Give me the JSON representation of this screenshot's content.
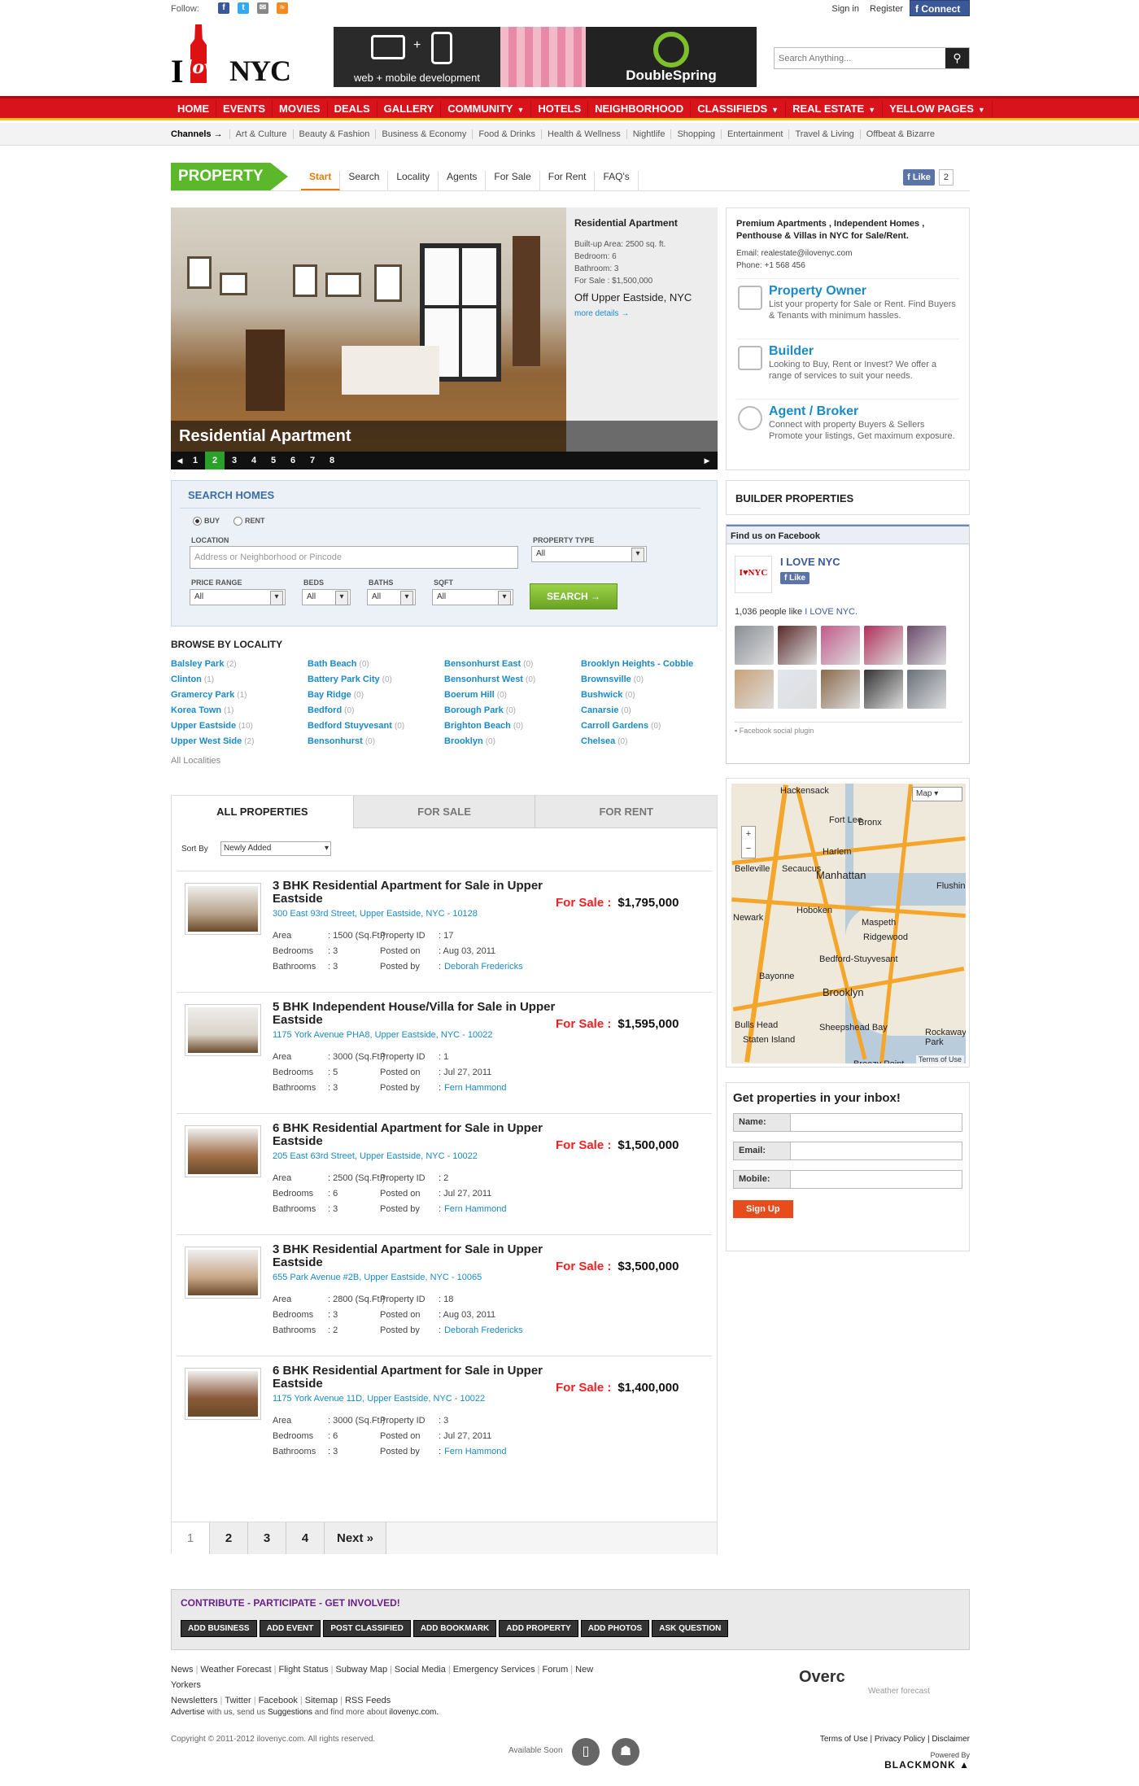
{
  "topbar": {
    "follow_label": "Follow:",
    "signin": "Sign in",
    "register": "Register",
    "connect": "Connect"
  },
  "header": {
    "logo_text_i": "I",
    "logo_text_love": "love",
    "logo_text_nyc": "NYC",
    "banner_left": "web + mobile development",
    "banner_right": "DoubleSpring",
    "search_placeholder": "Search Anything...",
    "search_icon": "magnifier-icon"
  },
  "nav": {
    "items": [
      "HOME",
      "EVENTS",
      "MOVIES",
      "DEALS",
      "GALLERY",
      "COMMUNITY",
      "HOTELS",
      "NEIGHBORHOOD",
      "CLASSIFIEDS",
      "REAL ESTATE",
      "YELLOW PAGES"
    ],
    "dropdown_items": [
      "COMMUNITY",
      "CLASSIFIEDS",
      "REAL ESTATE",
      "YELLOW PAGES"
    ]
  },
  "channels": {
    "label": "Channels →",
    "items": [
      "Art & Culture",
      "Beauty & Fashion",
      "Business & Economy",
      "Food & Drinks",
      "Health & Wellness",
      "Nightlife",
      "Shopping",
      "Entertainment",
      "Travel & Living",
      "Offbeat & Bizarre"
    ]
  },
  "property": {
    "badge": "PROPERTY",
    "tabs": [
      "Start",
      "Search",
      "Locality",
      "Agents",
      "For Sale",
      "For Rent",
      "FAQ's"
    ],
    "active_tab": "Start",
    "fb_like": "Like",
    "fb_like_count": "2"
  },
  "slider": {
    "side_title": "Residential Apartment",
    "area": "Built-up Area: 2500 sq. ft.",
    "bedroom": "Bedroom: 6",
    "bathroom": "Bathroom: 3",
    "for_sale": "For Sale : $1,500,000",
    "location": "Off Upper Eastside, NYC",
    "more": "more details →",
    "caption": "Residential Apartment",
    "pages": [
      "1",
      "2",
      "3",
      "4",
      "5",
      "6",
      "7",
      "8"
    ],
    "active_page": "2"
  },
  "owner": {
    "intro": "Premium Apartments , Independent Homes , Penthouse & Villas in NYC for Sale/Rent.",
    "email": "Email: realestate@ilovenyc.com",
    "phone": "Phone: +1 568 456",
    "items": [
      {
        "title": "Property Owner",
        "desc": "List your property for Sale or Rent. Find Buyers & Tenants with minimum hassles."
      },
      {
        "title": "Builder",
        "desc": "Looking to Buy, Rent or Invest? We offer a range of services to suit your needs."
      },
      {
        "title": "Agent / Broker",
        "desc": "Connect with property Buyers & Sellers Promote your listings, Get maximum exposure."
      }
    ]
  },
  "builder_properties": "BUILDER PROPERTIES",
  "facebook": {
    "header": "Find us on Facebook",
    "page_name": "I LOVE NYC",
    "like": "Like",
    "people_prefix": "1,036 people like",
    "people_page": "I LOVE NYC.",
    "plugin": "Facebook social plugin",
    "face_colors": [
      "#8a8f94",
      "#5a2a2a",
      "#c25a8a",
      "#b0305a",
      "#6a4a6a",
      "#caa27a",
      "#e2e6ec",
      "#8a6a4a",
      "#333333",
      "#6a7078"
    ]
  },
  "map": {
    "type_label": "Map",
    "terms": "Terms of Use",
    "labels": [
      "Hackensack",
      "Fort Lee",
      "Bronx",
      "Harlem",
      "Manhattan",
      "Secaucus",
      "Belleville",
      "Hoboken",
      "Newark",
      "Maspeth",
      "Ridgewood",
      "Bedford-Stuyvesant",
      "Bayonne",
      "Brooklyn",
      "Bulls Head",
      "Staten Island",
      "Sheepshead Bay",
      "Breezy Point",
      "Rockaway Park",
      "Flushing"
    ]
  },
  "newsletter": {
    "title": "Get properties in your inbox!",
    "fields": [
      "Name:",
      "Email:",
      "Mobile:"
    ],
    "signup": "Sign Up"
  },
  "search_homes": {
    "title": "SEARCH HOMES",
    "buy": "BUY",
    "rent": "RENT",
    "location_label": "LOCATION",
    "location_placeholder": "Address or Neighborhood or Pincode",
    "property_type_label": "PROPERTY TYPE",
    "property_type_value": "All",
    "price_label": "PRICE RANGE",
    "price_value": "All",
    "beds_label": "BEDS",
    "beds_value": "All",
    "baths_label": "BATHS",
    "baths_value": "All",
    "sqft_label": "SQFT",
    "sqft_value": "All",
    "search_button": "SEARCH →"
  },
  "browse": {
    "title": "BROWSE BY LOCALITY",
    "columns": [
      [
        {
          "name": "Balsley Park",
          "count": "(2)"
        },
        {
          "name": "Clinton",
          "count": "(1)"
        },
        {
          "name": "Gramercy Park",
          "count": "(1)"
        },
        {
          "name": "Korea Town",
          "count": "(1)"
        },
        {
          "name": "Upper Eastside",
          "count": "(10)"
        },
        {
          "name": "Upper West Side",
          "count": "(2)"
        }
      ],
      [
        {
          "name": "Bath Beach",
          "count": "(0)"
        },
        {
          "name": "Battery Park City",
          "count": "(0)"
        },
        {
          "name": "Bay Ridge",
          "count": "(0)"
        },
        {
          "name": "Bedford",
          "count": "(0)"
        },
        {
          "name": "Bedford Stuyvesant",
          "count": "(0)"
        },
        {
          "name": "Bensonhurst",
          "count": "(0)"
        }
      ],
      [
        {
          "name": "Bensonhurst East",
          "count": "(0)"
        },
        {
          "name": "Bensonhurst West",
          "count": "(0)"
        },
        {
          "name": "Boerum Hill",
          "count": "(0)"
        },
        {
          "name": "Borough Park",
          "count": "(0)"
        },
        {
          "name": "Brighton Beach",
          "count": "(0)"
        },
        {
          "name": "Brooklyn",
          "count": "(0)"
        }
      ],
      [
        {
          "name": "Brooklyn Heights - Cobble",
          "count": ""
        },
        {
          "name": "Brownsville",
          "count": "(0)"
        },
        {
          "name": "Bushwick",
          "count": "(0)"
        },
        {
          "name": "Canarsie",
          "count": "(0)"
        },
        {
          "name": "Carroll Gardens",
          "count": "(0)"
        },
        {
          "name": "Chelsea",
          "count": "(0)"
        }
      ]
    ],
    "all": "All Localities"
  },
  "listing": {
    "tabs": [
      "ALL PROPERTIES",
      "FOR SALE",
      "FOR RENT"
    ],
    "sort_label": "Sort By",
    "sort_value": "Newly Added",
    "for_sale_label": "For Sale :",
    "labels": {
      "area": "Area",
      "bedrooms": "Bedrooms",
      "bathrooms": "Bathrooms",
      "property_id": "Property ID",
      "posted_on": "Posted on",
      "posted_by": "Posted by"
    },
    "cards": [
      {
        "title": "3 BHK Residential Apartment for Sale in Upper Eastside",
        "price": "$1,795,000",
        "address": "300 East 93rd Street, Upper Eastside, NYC - 10128",
        "area": ": 1500 (Sq.Ft.)",
        "bedrooms": ": 3",
        "bathrooms": ": 3",
        "property_id": ": 17",
        "posted_on": ": Aug 03, 2011",
        "posted_by_sep": ":",
        "posted_by": "Deborah Fredericks",
        "thumb_color": "#b9a48c"
      },
      {
        "title": "5 BHK Independent House/Villa for Sale in Upper Eastside",
        "price": "$1,595,000",
        "address": "1175 York Avenue PHA8, Upper Eastside, NYC - 10022",
        "area": ": 3000 (Sq.Ft.)",
        "bedrooms": ": 5",
        "bathrooms": ": 3",
        "property_id": ": 1",
        "posted_on": ": Jul 27, 2011",
        "posted_by_sep": ":",
        "posted_by": "Fern Hammond",
        "thumb_color": "#d9d3c8"
      },
      {
        "title": "6 BHK Residential Apartment for Sale in Upper Eastside",
        "price": "$1,500,000",
        "address": "205 East 63rd Street, Upper Eastside, NYC - 10022",
        "area": ": 2500 (Sq.Ft.)",
        "bedrooms": ": 6",
        "bathrooms": ": 3",
        "property_id": ": 2",
        "posted_on": ": Jul 27, 2011",
        "posted_by_sep": ":",
        "posted_by": "Fern Hammond",
        "thumb_color": "#a0704a"
      },
      {
        "title": "3 BHK Residential Apartment for Sale in Upper Eastside",
        "price": "$3,500,000",
        "address": "655 Park Avenue #2B, Upper Eastside, NYC - 10065",
        "area": ": 2800 (Sq.Ft.)",
        "bedrooms": ": 3",
        "bathrooms": ": 2",
        "property_id": ": 18",
        "posted_on": ": Aug 03, 2011",
        "posted_by_sep": ":",
        "posted_by": "Deborah Fredericks",
        "thumb_color": "#c9a88a"
      },
      {
        "title": "6 BHK Residential Apartment for Sale in Upper Eastside",
        "price": "$1,400,000",
        "address": "1175 York Avenue 11D, Upper Eastside, NYC - 10022",
        "area": ": 3000 (Sq.Ft.)",
        "bedrooms": ": 6",
        "bathrooms": ": 3",
        "property_id": ": 3",
        "posted_on": ": Jul 27, 2011",
        "posted_by_sep": ":",
        "posted_by": "Fern Hammond",
        "thumb_color": "#8a5a3a"
      }
    ],
    "pages": [
      "1",
      "2",
      "3",
      "4"
    ],
    "next": "Next »"
  },
  "footer": {
    "contribute_title": "CONTRIBUTE - PARTICIPATE - GET INVOLVED!",
    "contribute_buttons": [
      "ADD BUSINESS",
      "ADD EVENT",
      "POST CLASSIFIED",
      "ADD BOOKMARK",
      "ADD PROPERTY",
      "ADD PHOTOS",
      "ASK QUESTION"
    ],
    "links_row1": [
      "News",
      "Weather Forecast",
      "Flight Status",
      "Subway Map",
      "Social Media",
      "Emergency Services",
      "Forum",
      "New Yorkers"
    ],
    "links_row2": [
      "Newsletters",
      "Twitter",
      "Facebook",
      "Sitemap",
      "RSS Feeds"
    ],
    "weather": "Overc",
    "weather_label": "Weather forecast",
    "advertise_prefix": "Advertise",
    "advertise_mid": "with us, send us",
    "suggestions": "Suggestions",
    "advertise_suffix": "and find more about",
    "site": "ilovenyc.com.",
    "copyright": "Copyright © 2011-2012 ilovenyc.com. All rights reserved.",
    "available_soon": "Available Soon",
    "legal": [
      "Terms of Use",
      "Privacy Policy",
      "Disclaimer"
    ],
    "powered_by": "Powered By",
    "powered_brand": "BLACKMONK"
  },
  "colors": {
    "nav_red": "#d8131c",
    "property_green": "#5cb82b",
    "link_blue": "#1a8ac6",
    "sale_red": "#e22"
  }
}
